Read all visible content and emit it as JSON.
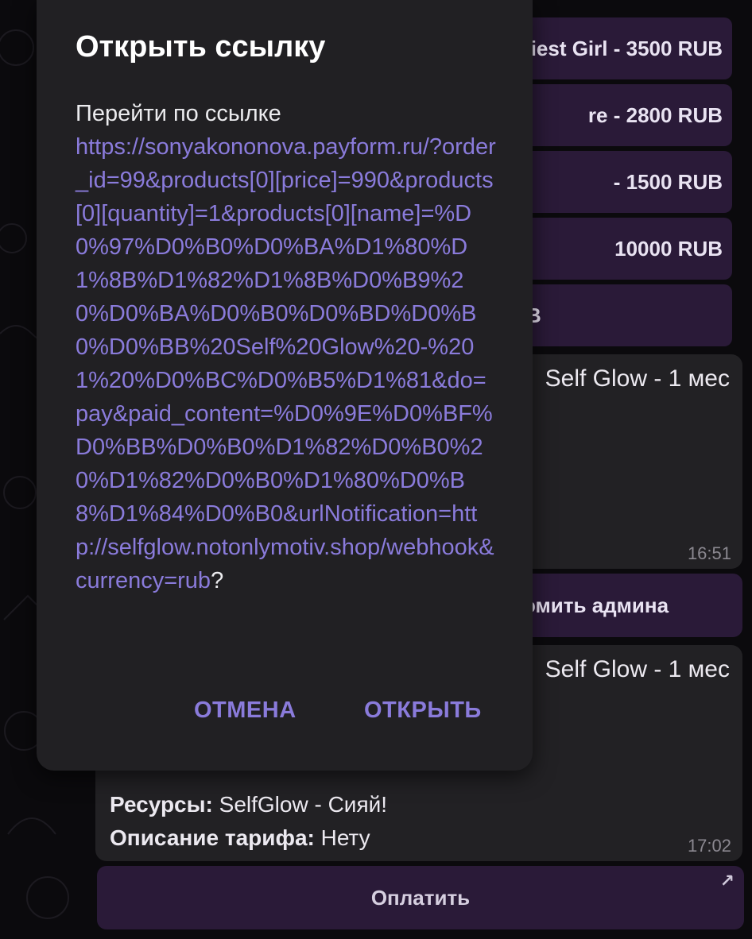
{
  "dialog": {
    "title": "Открыть ссылку",
    "prompt": "Перейти по ссылке",
    "url": "https://sonyakononova.payform.ru/?order_id=99&products[0][price]=990&products[0][quantity]=1&products[0][name]=%D0%97%D0%B0%D0%BA%D1%80%D1%8B%D1%82%D1%8B%D0%B9%20%D0%BA%D0%B0%D0%BD%D0%B0%D0%BB%20Self%20Glow%20-%201%20%D0%BC%D0%B5%D1%81&do=pay&paid_content=%D0%9E%D0%BF%D0%BB%D0%B0%D1%82%D0%B0%20%D1%82%D0%B0%D1%80%D0%B8%D1%84%D0%B0&urlNotification=http://selfglow.notonlymotiv.shop/webhook&currency=rub",
    "question_mark": "?",
    "cancel_label": "ОТМЕНА",
    "open_label": "ОТКРЫТЬ"
  },
  "keyboard_buttons": [
    "iest Girl - 3500 RUB",
    "re - 2800 RUB",
    "- 1500 RUB",
    "10000 RUB",
    "B"
  ],
  "messages": [
    {
      "head": "Self Glow - 1 мес",
      "time": "16:51"
    },
    {
      "head": "Self Glow - 1 мес",
      "time": "17:02",
      "rows": [
        {
          "label": "Ресурсы:",
          "value": " SelfGlow - Сияй!"
        },
        {
          "label": "Описание тарифа:",
          "value": " Нету"
        }
      ]
    }
  ],
  "remind_button": "омить админа",
  "pay_button": "Оплатить",
  "pay_button_icon": "arrow-up-right-icon",
  "colors": {
    "accent": "#8a7bdb",
    "dialog_bg": "#212023",
    "button_bg": "#2a1a38"
  }
}
